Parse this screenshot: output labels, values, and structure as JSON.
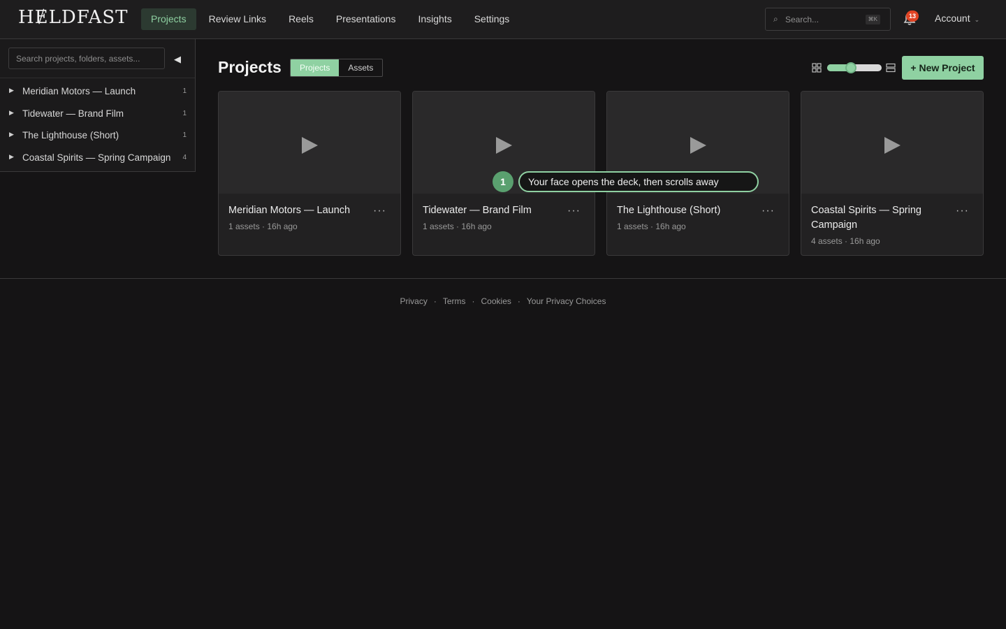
{
  "header": {
    "logo_text": "HɆLDFAST",
    "nav": [
      {
        "label": "Projects",
        "active": true
      },
      {
        "label": "Review Links",
        "active": false
      },
      {
        "label": "Presentations",
        "active": false
      },
      {
        "label": "Reels",
        "active": false
      },
      {
        "label": "Insights",
        "active": false
      },
      {
        "label": "Settings",
        "active": false
      }
    ],
    "search_placeholder": "Search...",
    "search_shortcut": "⌘K",
    "notification_count": "13",
    "account_label": "Account"
  },
  "sidebar": {
    "search_placeholder": "Search projects, folders, assets...",
    "collapse_glyph": "◀",
    "items": [
      {
        "label": "Meridian Motors — Launch",
        "count": "1"
      },
      {
        "label": "Tidewater — Brand Film",
        "count": "1"
      },
      {
        "label": "The Lighthouse (Short)",
        "count": "1"
      },
      {
        "label": "Coastal Spirits — Spring Campaign",
        "count": "4"
      }
    ]
  },
  "main": {
    "title": "Projects",
    "segments": [
      {
        "label": "Projects",
        "active": true
      },
      {
        "label": "Assets",
        "active": false
      }
    ],
    "thumb_size_fraction": 0.42,
    "new_project_label": "+ New Project",
    "projects": [
      {
        "title": "Meridian Motors — Launch",
        "meta": "1 assets · 16h ago"
      },
      {
        "title": "Tidewater — Brand Film",
        "meta": "1 assets · 16h ago"
      },
      {
        "title": "The Lighthouse (Short)",
        "meta": "1 assets · 16h ago"
      },
      {
        "title": "Coastal Spirits — Spring Campaign",
        "meta": "4 assets · 16h ago"
      }
    ]
  },
  "tour": {
    "step": "1",
    "text": "Your face opens the deck, then scrolls away"
  },
  "footer": {
    "links": [
      "Privacy",
      "Terms",
      "Cookies",
      "Your Privacy Choices"
    ]
  },
  "colors": {
    "accent": "#8fd1a2",
    "badge": "#e04323",
    "background": "#151415"
  }
}
